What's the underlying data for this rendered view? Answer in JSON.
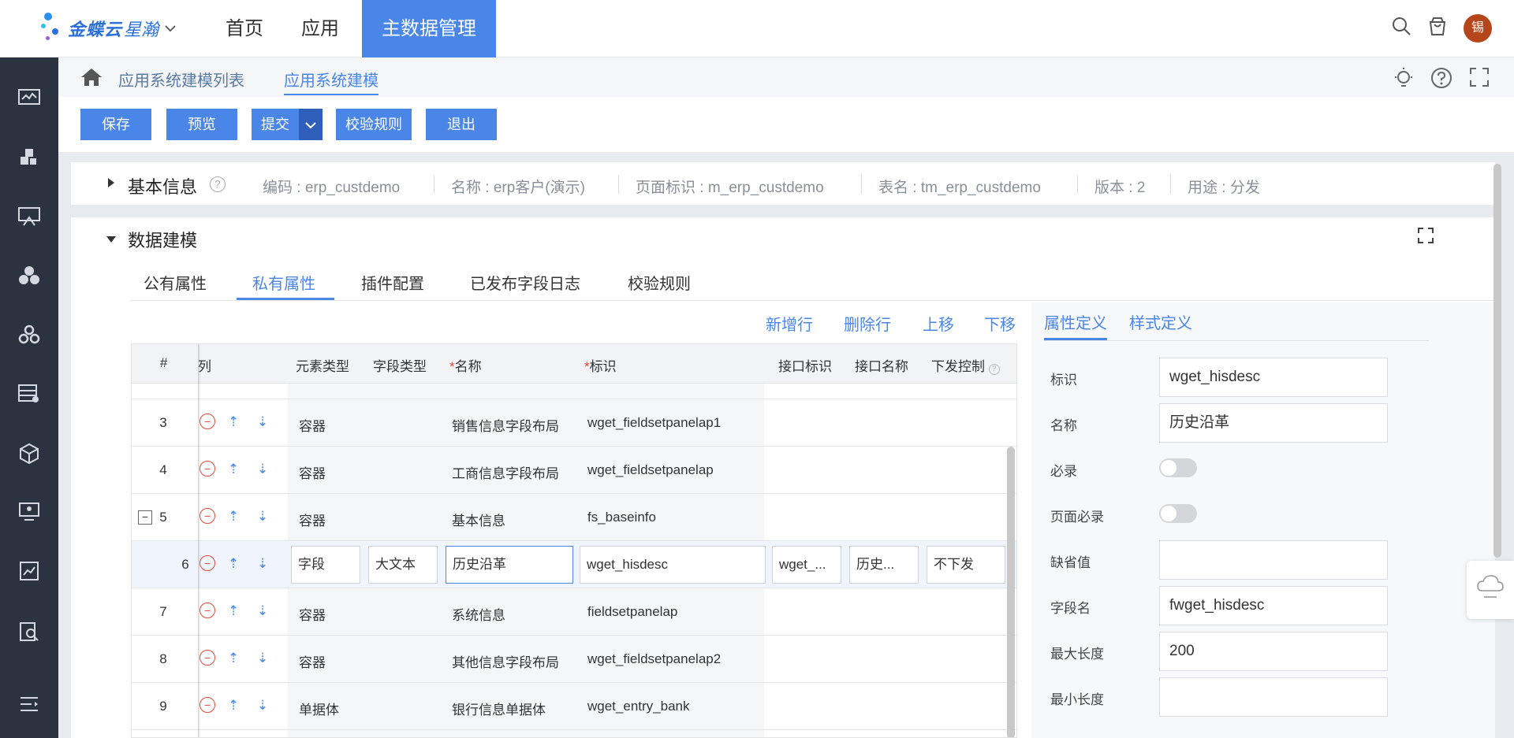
{
  "app": {
    "logo_brand": "金蝶云",
    "logo_product": "星瀚",
    "nav": [
      {
        "label": "首页"
      },
      {
        "label": "应用"
      },
      {
        "label": "主数据管理"
      }
    ],
    "avatar_text": "锡"
  },
  "icons": {
    "top": [
      "search-icon",
      "bag-icon"
    ],
    "sidebar": [
      "monitor-chart-icon",
      "puzzle-icon",
      "presentation-icon",
      "cluster-icon",
      "gears-cluster-icon",
      "table-settings-icon",
      "cube-icon",
      "screen-user-icon",
      "report-chart-icon",
      "clipboard-search-icon",
      "menu-collapse-icon"
    ],
    "crumb_right": [
      "bulb-icon",
      "help-icon",
      "fullscreen-icon"
    ]
  },
  "breadcrumb": {
    "items": [
      {
        "label": "应用系统建模列表"
      },
      {
        "label": "应用系统建模"
      }
    ]
  },
  "toolbar": {
    "save": "保存",
    "preview": "预览",
    "submit": "提交",
    "validate": "校验规则",
    "exit": "退出"
  },
  "basic_info": {
    "title": "基本信息",
    "items": [
      {
        "text": "编码 : erp_custdemo"
      },
      {
        "text": "名称 : erp客户(演示)"
      },
      {
        "text": "页面标识 : m_erp_custdemo"
      },
      {
        "text": "表名 : tm_erp_custdemo"
      },
      {
        "text": "版本 : 2"
      },
      {
        "text": "用途 : 分发"
      }
    ]
  },
  "data_model": {
    "title": "数据建模",
    "tabs": [
      {
        "label": "公有属性"
      },
      {
        "label": "私有属性"
      },
      {
        "label": "插件配置"
      },
      {
        "label": "已发布字段日志"
      },
      {
        "label": "校验规则"
      }
    ],
    "actions": {
      "add_row": "新增行",
      "delete_row": "删除行",
      "move_up": "上移",
      "move_down": "下移"
    },
    "grid": {
      "headers": {
        "index": "#",
        "col_partial": "列",
        "element_type": "元素类型",
        "field_type": "字段类型",
        "name": "名称",
        "key": "标识",
        "api_key": "接口标识",
        "api_name": "接口名称",
        "dispatch": "下发控制"
      },
      "rows": [
        {
          "num": "3",
          "element_type": "容器",
          "field_type": "",
          "name": "销售信息字段布局",
          "key": "wget_fieldsetpanelap1"
        },
        {
          "num": "4",
          "element_type": "容器",
          "field_type": "",
          "name": "工商信息字段布局",
          "key": "wget_fieldsetpanelap"
        },
        {
          "num": "5",
          "element_type": "容器",
          "field_type": "",
          "name": "基本信息",
          "key": "fs_baseinfo"
        },
        {
          "num": "6",
          "element_type": "字段",
          "field_type": "大文本",
          "name": "历史沿革",
          "key": "wget_hisdesc",
          "api_key": "wget_...",
          "api_name": "历史...",
          "dispatch": "不下发"
        },
        {
          "num": "7",
          "element_type": "容器",
          "field_type": "",
          "name": "系统信息",
          "key": "fieldsetpanelap"
        },
        {
          "num": "8",
          "element_type": "容器",
          "field_type": "",
          "name": "其他信息字段布局",
          "key": "wget_fieldsetpanelap2"
        },
        {
          "num": "9",
          "element_type": "单据体",
          "field_type": "",
          "name": "银行信息单据体",
          "key": "wget_entry_bank"
        }
      ]
    }
  },
  "properties": {
    "tabs": [
      {
        "label": "属性定义"
      },
      {
        "label": "样式定义"
      }
    ],
    "fields": {
      "key_label": "标识",
      "key_value": "wget_hisdesc",
      "name_label": "名称",
      "name_value": "历史沿革",
      "required_label": "必录",
      "required_on": false,
      "page_required_label": "页面必录",
      "page_required_on": false,
      "default_label": "缺省值",
      "default_value": "",
      "field_name_label": "字段名",
      "field_name_value": "fwget_hisdesc",
      "max_len_label": "最大长度",
      "max_len_value": "200",
      "min_len_label": "最小长度",
      "min_len_value": ""
    }
  },
  "colors": {
    "accent": "#4a86e8",
    "sidebar": "#2c3340",
    "danger": "#e04a3a"
  }
}
